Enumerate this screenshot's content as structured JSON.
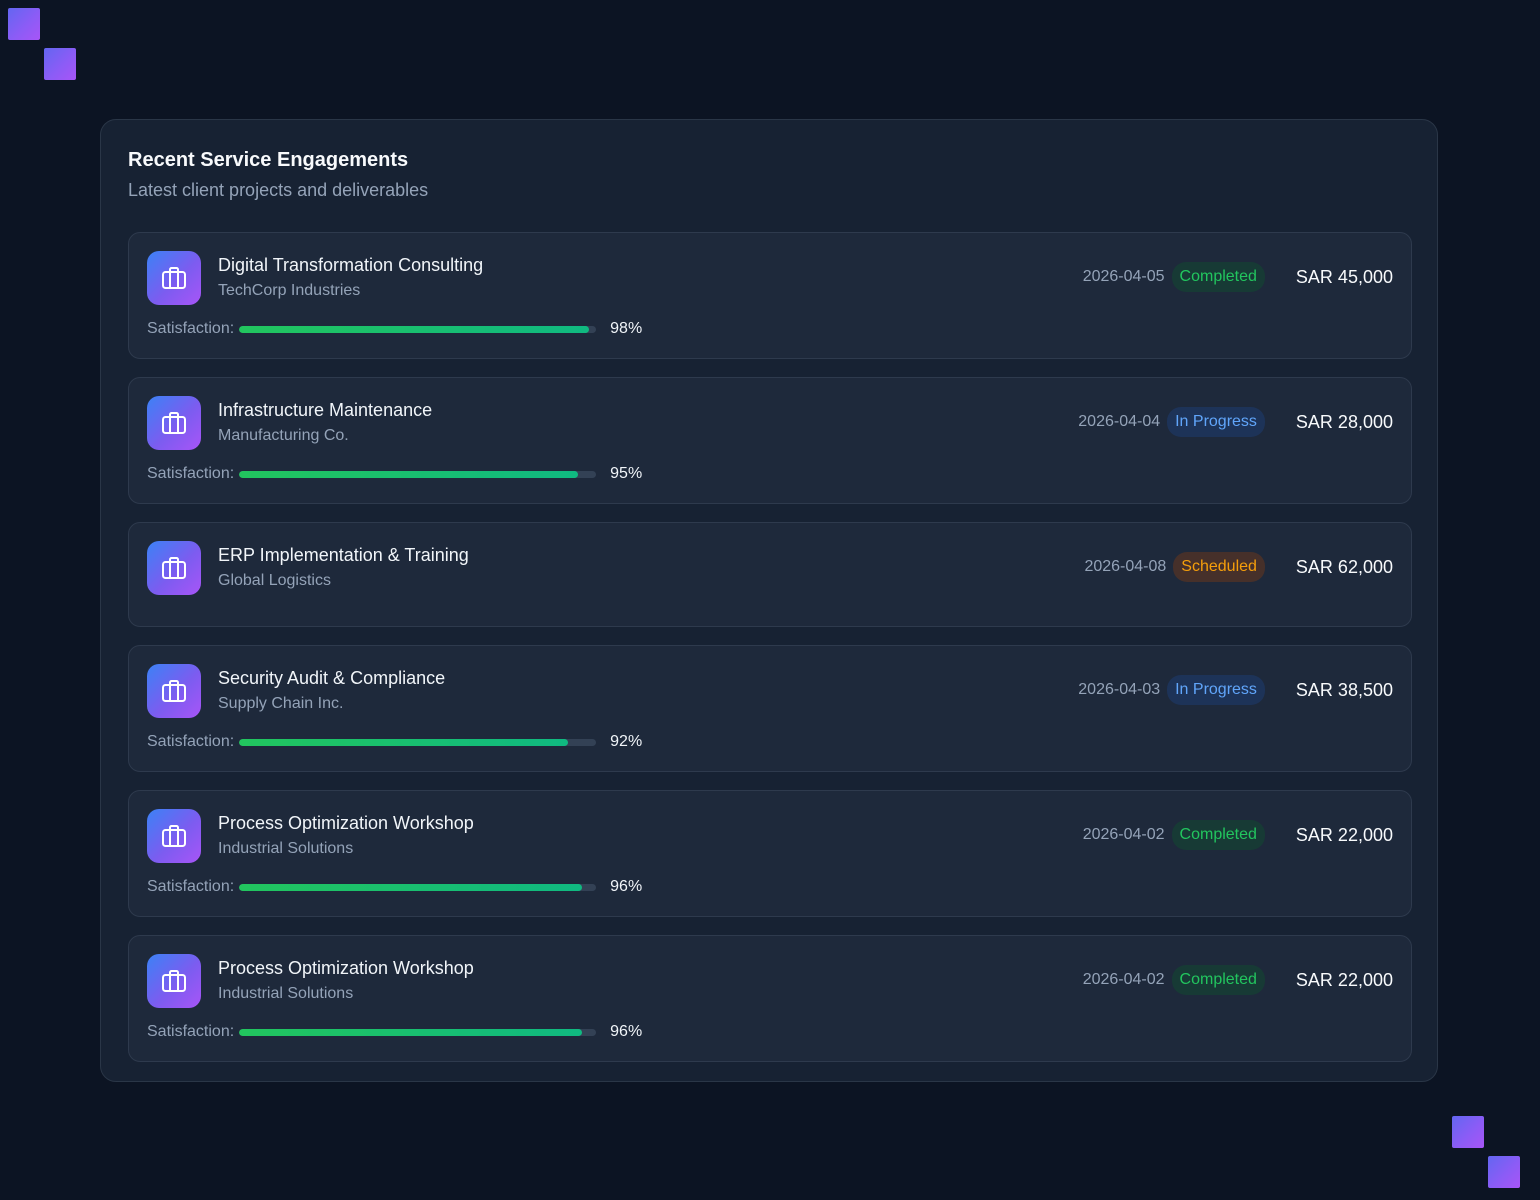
{
  "panel": {
    "title": "Recent Service Engagements",
    "subtitle": "Latest client projects and deliverables"
  },
  "labels": {
    "satisfaction": "Satisfaction:"
  },
  "colors": {
    "completed": "#22c55e",
    "in_progress": "#60a5fa",
    "scheduled": "#f59e0b",
    "accent_gradient_start": "#3b82f6",
    "accent_gradient_end": "#a855f7"
  },
  "engagements": [
    {
      "title": "Digital Transformation Consulting",
      "client": "TechCorp Industries",
      "date": "2026-04-05",
      "status": "Completed",
      "status_kind": "completed",
      "amount": "SAR 45,000",
      "satisfaction": 98,
      "satisfaction_text": "98%",
      "icon": "briefcase-icon"
    },
    {
      "title": "Infrastructure Maintenance",
      "client": "Manufacturing Co.",
      "date": "2026-04-04",
      "status": "In Progress",
      "status_kind": "progress",
      "amount": "SAR 28,000",
      "satisfaction": 95,
      "satisfaction_text": "95%",
      "icon": "briefcase-icon"
    },
    {
      "title": "ERP Implementation & Training",
      "client": "Global Logistics",
      "date": "2026-04-08",
      "status": "Scheduled",
      "status_kind": "scheduled",
      "amount": "SAR 62,000",
      "satisfaction": null,
      "satisfaction_text": null,
      "icon": "briefcase-icon"
    },
    {
      "title": "Security Audit & Compliance",
      "client": "Supply Chain Inc.",
      "date": "2026-04-03",
      "status": "In Progress",
      "status_kind": "progress",
      "amount": "SAR 38,500",
      "satisfaction": 92,
      "satisfaction_text": "92%",
      "icon": "briefcase-icon"
    },
    {
      "title": "Process Optimization Workshop",
      "client": "Industrial Solutions",
      "date": "2026-04-02",
      "status": "Completed",
      "status_kind": "completed",
      "amount": "SAR 22,000",
      "satisfaction": 96,
      "satisfaction_text": "96%",
      "icon": "briefcase-icon"
    },
    {
      "title": "Process Optimization Workshop",
      "client": "Industrial Solutions",
      "date": "2026-04-02",
      "status": "Completed",
      "status_kind": "completed",
      "amount": "SAR 22,000",
      "satisfaction": 96,
      "satisfaction_text": "96%",
      "icon": "briefcase-icon"
    }
  ]
}
